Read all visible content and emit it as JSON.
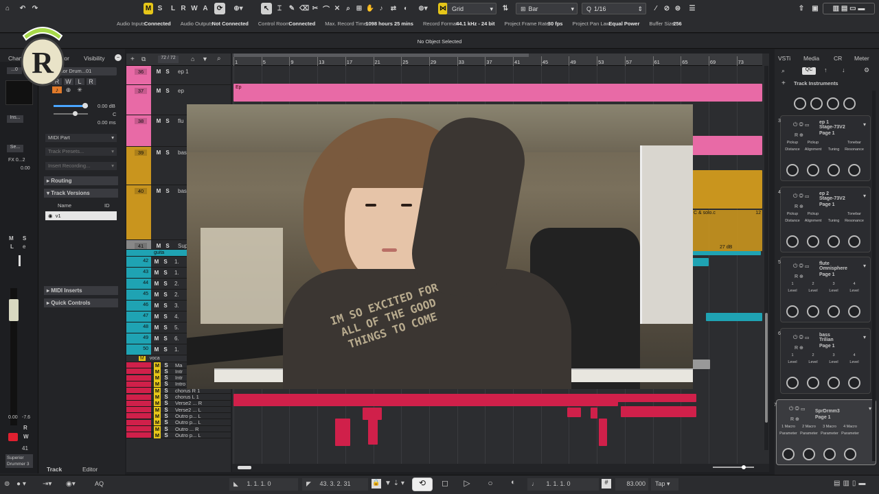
{
  "toolbar": {
    "m": "M",
    "s": "S",
    "l": "L",
    "r": "R",
    "w": "W",
    "a": "A",
    "grid_label": "Grid",
    "bar_label": "Bar",
    "quantize": "1/16"
  },
  "status": [
    {
      "label": "Audio Inputs",
      "value": "Connected"
    },
    {
      "label": "Audio Outputs",
      "value": "Not Connected"
    },
    {
      "label": "Control Room",
      "value": "Connected"
    },
    {
      "label": "Max. Record Time",
      "value": "1098 hours 25 mins"
    },
    {
      "label": "Record Format",
      "value": "44.1 kHz - 24 bit"
    },
    {
      "label": "Project Frame Rate",
      "value": "30 fps"
    },
    {
      "label": "Project Pan Law",
      "value": "Equal Power"
    },
    {
      "label": "Buffer Size",
      "value": "256"
    }
  ],
  "info_line": "No Object Selected",
  "inspector": {
    "tabs": [
      "Channel",
      "Inspector",
      "Visibility"
    ],
    "track_name": "Superior Drum...01",
    "volume": "0.00 dB",
    "pan": "C",
    "delay": "0.00 ms",
    "midi_part": "MIDI Part",
    "track_presets": "Track Presets...",
    "insert_recording": "Insert Recording...",
    "sections": [
      "Routing",
      "Track Versions",
      "MIDI Inserts",
      "Quick Controls"
    ],
    "versions_header": [
      "Name",
      "ID"
    ],
    "version_row": "v1",
    "fx": "FX 0...2",
    "fx_val": "0.00",
    "bottom_tabs": [
      "Track",
      "Editor"
    ],
    "ch_name": "Superior Drummer 3",
    "ch_num": "41",
    "ch_vol": "0.00",
    "ch_pan": "-7.6",
    "ins": "Ins...",
    "se": "Se..."
  },
  "track_count": "72 / 72",
  "tracks": [
    {
      "num": "36",
      "name": "ep 1",
      "color": "#e86aa6"
    },
    {
      "num": "37",
      "name": "ep",
      "color": "#e86aa6"
    },
    {
      "num": "38",
      "name": "flu",
      "color": "#e86aa6"
    },
    {
      "num": "39",
      "name": "bass",
      "color": "#c9951e"
    },
    {
      "num": "40",
      "name": "bass",
      "color": "#c9951e"
    },
    {
      "num": "41",
      "name": "Supe",
      "color": "#888888"
    }
  ],
  "guitar_tracks": [
    "42",
    "43",
    "44",
    "45",
    "46",
    "47",
    "48",
    "49",
    "50"
  ],
  "guitar_names": [
    "1.",
    "1.",
    "2.",
    "2.",
    "3.",
    "4.",
    "5.",
    "6.",
    "1."
  ],
  "vocal_tracks": [
    "Ma",
    "Intr",
    "Intr",
    "Intro lo... L",
    "chorus R 1",
    "chorus L 1",
    "Verse2 ... R",
    "Verse2 ... L",
    "Outro p... L",
    "Outro p... L",
    "Outro ... R",
    "Outro p... L"
  ],
  "folder_guitar": "guita",
  "folder_vocal": "voca",
  "ruler": [
    "1",
    "5",
    "9",
    "13",
    "17",
    "21",
    "25",
    "29",
    "33",
    "37",
    "41",
    "45",
    "49",
    "53",
    "57",
    "61",
    "65",
    "69",
    "73"
  ],
  "parts": {
    "ep": "Ep",
    "bass_solo": "C & solo.c",
    "bass_n": "12",
    "bass_tail": "27 dB"
  },
  "right_tabs": [
    "VSTi",
    "Media",
    "CR",
    "Meter"
  ],
  "track_instruments": "Track Instruments",
  "instruments": [
    {
      "slot": "3",
      "track": "ep 1",
      "name": "Stage-73V2",
      "page": "Page 1",
      "params": [
        "Pickup",
        "Pickup",
        "",
        "Tonebar"
      ],
      "params2": [
        "Distance",
        "Alignment",
        "Tuning",
        "Resonance"
      ]
    },
    {
      "slot": "4",
      "track": "ep 2",
      "name": "Stage-73V2",
      "page": "Page 1",
      "params": [
        "Pickup",
        "Pickup",
        "",
        "Tonebar"
      ],
      "params2": [
        "Distance",
        "Alignment",
        "Tuning",
        "Resonance"
      ]
    },
    {
      "slot": "5",
      "track": "flute",
      "name": "Omnisphere",
      "page": "Page 1",
      "params": [
        "1",
        "2",
        "3",
        "4"
      ],
      "params2": [
        "Level",
        "Level",
        "Level",
        "Level"
      ]
    },
    {
      "slot": "6",
      "track": "bass",
      "name": "Trilian",
      "page": "Page 1",
      "params": [
        "1",
        "2",
        "3",
        "4"
      ],
      "params2": [
        "Level",
        "Level",
        "Level",
        "Level"
      ]
    },
    {
      "slot": "7",
      "track": "",
      "name": "SprDrmm3",
      "page": "Page 1",
      "params": [
        "1 Macro",
        "2 Macro",
        "3 Macro",
        "4 Macro"
      ],
      "params2": [
        "Parameter",
        "Parameter",
        "Parameter",
        "Parameter"
      ]
    }
  ],
  "transport": {
    "left_loc": "1. 1. 1. 0",
    "right_loc": "43. 3. 2. 31",
    "position": "1. 1. 1. 0",
    "tempo": "83.000",
    "tap": "Tap",
    "aq": "AQ"
  },
  "webcam_text": "IM SO EXCITED FOR ALL OF THE GOOD THINGS TO COME"
}
